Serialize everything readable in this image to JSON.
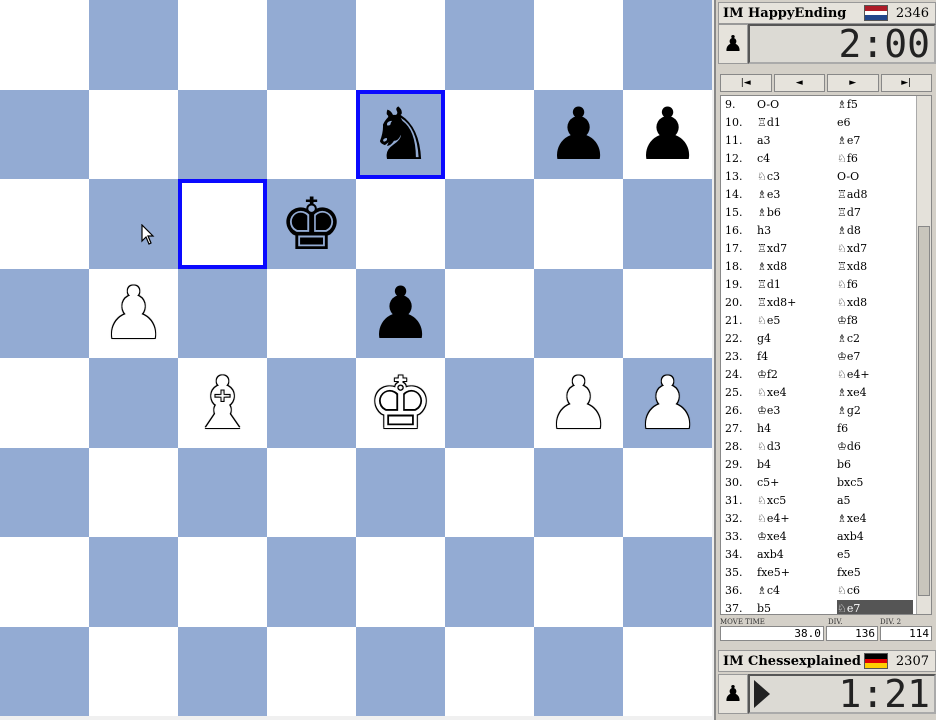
{
  "board": {
    "light_color": "#ffffff",
    "dark_color": "#93abd3",
    "highlight_color": "#0a0aff",
    "highlighted_squares": [
      "e7",
      "c6"
    ],
    "pieces": [
      {
        "square": "e7",
        "color": "black",
        "type": "knight"
      },
      {
        "square": "g7",
        "color": "black",
        "type": "pawn"
      },
      {
        "square": "h7",
        "color": "black",
        "type": "pawn"
      },
      {
        "square": "d6",
        "color": "black",
        "type": "king"
      },
      {
        "square": "b5",
        "color": "white",
        "type": "pawn"
      },
      {
        "square": "e5",
        "color": "black",
        "type": "pawn"
      },
      {
        "square": "c4",
        "color": "white",
        "type": "bishop"
      },
      {
        "square": "e4",
        "color": "white",
        "type": "king"
      },
      {
        "square": "g4",
        "color": "white",
        "type": "pawn"
      },
      {
        "square": "h4",
        "color": "white",
        "type": "pawn"
      }
    ]
  },
  "top_player": {
    "name": "IM HappyEnding",
    "rating": "2346",
    "clock": "2:00",
    "flag": "netherlands"
  },
  "bottom_player": {
    "name": "IM Chessexplained",
    "rating": "2307",
    "clock": "1:21",
    "flag": "germany"
  },
  "nav_buttons": [
    "|◄",
    "◄",
    "►",
    "►|"
  ],
  "moves": [
    {
      "n": "9.",
      "w": "O-O",
      "b": "♗f5"
    },
    {
      "n": "10.",
      "w": "♖d1",
      "b": "e6"
    },
    {
      "n": "11.",
      "w": "a3",
      "b": "♗e7"
    },
    {
      "n": "12.",
      "w": "c4",
      "b": "♘f6"
    },
    {
      "n": "13.",
      "w": "♘c3",
      "b": "O-O"
    },
    {
      "n": "14.",
      "w": "♗e3",
      "b": "♖ad8"
    },
    {
      "n": "15.",
      "w": "♗b6",
      "b": "♖d7"
    },
    {
      "n": "16.",
      "w": "h3",
      "b": "♗d8"
    },
    {
      "n": "17.",
      "w": "♖xd7",
      "b": "♘xd7"
    },
    {
      "n": "18.",
      "w": "♗xd8",
      "b": "♖xd8"
    },
    {
      "n": "19.",
      "w": "♖d1",
      "b": "♘f6"
    },
    {
      "n": "20.",
      "w": "♖xd8+",
      "b": "♘xd8"
    },
    {
      "n": "21.",
      "w": "♘e5",
      "b": "♔f8"
    },
    {
      "n": "22.",
      "w": "g4",
      "b": "♗c2"
    },
    {
      "n": "23.",
      "w": "f4",
      "b": "♔e7"
    },
    {
      "n": "24.",
      "w": "♔f2",
      "b": "♘e4+"
    },
    {
      "n": "25.",
      "w": "♘xe4",
      "b": "♗xe4"
    },
    {
      "n": "26.",
      "w": "♔e3",
      "b": "♗g2"
    },
    {
      "n": "27.",
      "w": "h4",
      "b": "f6"
    },
    {
      "n": "28.",
      "w": "♘d3",
      "b": "♔d6"
    },
    {
      "n": "29.",
      "w": "b4",
      "b": "b6"
    },
    {
      "n": "30.",
      "w": "c5+",
      "b": "bxc5"
    },
    {
      "n": "31.",
      "w": "♘xc5",
      "b": "a5"
    },
    {
      "n": "32.",
      "w": "♘e4+",
      "b": "♗xe4"
    },
    {
      "n": "33.",
      "w": "♔xe4",
      "b": "axb4"
    },
    {
      "n": "34.",
      "w": "axb4",
      "b": "e5"
    },
    {
      "n": "35.",
      "w": "fxe5+",
      "b": "fxe5"
    },
    {
      "n": "36.",
      "w": "♗c4",
      "b": "♘c6"
    },
    {
      "n": "37.",
      "w": "b5",
      "b": "♘e7"
    }
  ],
  "stats": {
    "labels": [
      "MOVE TIME",
      "DIV.",
      "DIV. 2"
    ],
    "values": [
      "38.0",
      "136",
      "114"
    ]
  }
}
